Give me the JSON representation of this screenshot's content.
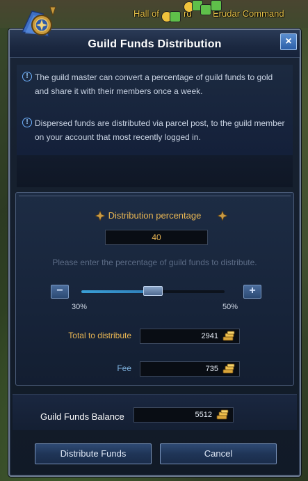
{
  "map": {
    "labels": [
      "Hall of",
      "rd",
      "Erudar Command"
    ]
  },
  "window": {
    "title": "Guild Funds Distribution",
    "close_icon": "×"
  },
  "info": {
    "line1": "The guild master can convert a percentage of guild funds to gold and share it with their members once a week.",
    "line2": "Dispersed funds are distributed via parcel post, to the guild member on your account that most recently logged in.",
    "info_icon": "!"
  },
  "distribution": {
    "title": "Distribution percentage",
    "percentage": "40",
    "hint": "Please enter the percentage of guild funds to distribute.",
    "minus_label": "−",
    "plus_label": "+",
    "range_min": "30%",
    "range_max": "50%",
    "slider_fraction": 0.5,
    "total_label": "Total to distribute",
    "total_value": "2941",
    "fee_label": "Fee",
    "fee_value": "735"
  },
  "balance": {
    "label": "Guild Funds Balance",
    "value": "5512"
  },
  "buttons": {
    "distribute": "Distribute Funds",
    "cancel": "Cancel"
  },
  "colors": {
    "accent_gold": "#e9b653",
    "fee_blue": "#7fb3e0",
    "slider_fill": "#3a9fd6"
  }
}
